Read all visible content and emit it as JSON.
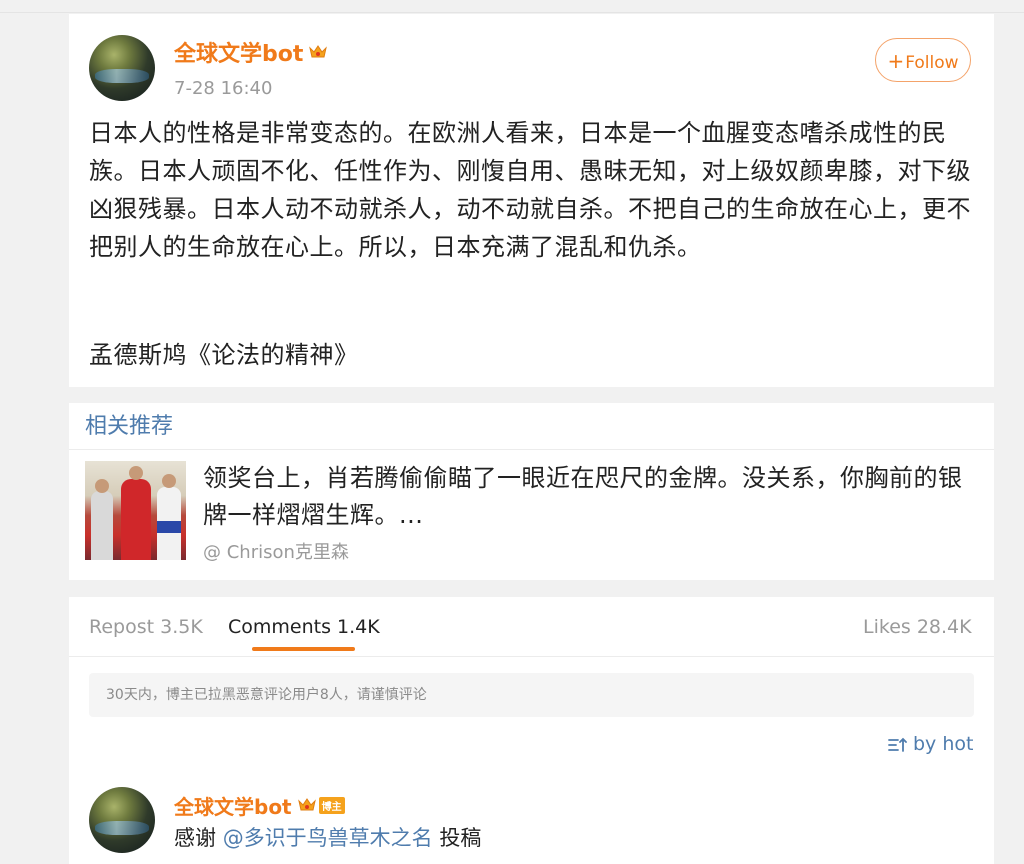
{
  "post": {
    "author": "全球文学bot",
    "timestamp": "7-28 16:40",
    "follow_label": "Follow",
    "text": "日本人的性格是非常变态的。在欧洲人看来，日本是一个血腥变态嗜杀成性的民族。日本人顽固不化、任性作为、刚愎自用、愚昧无知，对上级奴颜卑膝，对下级 凶狠残暴。日本人动不动就杀人，动不动就自杀。不把自己的生命放在心上，更不把别人的生命放在心上。所以，日本充满了混乱和仇杀。",
    "source": "孟德斯鸠《论法的精神》"
  },
  "recommendations": {
    "header": "相关推荐",
    "items": [
      {
        "text": "领奖台上，肖若腾偷偷瞄了一眼近在咫尺的金牌。没关系，你胸前的银牌一样熠熠生辉。...",
        "author": "@ Chrison克里森"
      }
    ]
  },
  "comments_section": {
    "tabs": [
      {
        "label": "Repost 3.5K"
      },
      {
        "label": "Comments 1.4K"
      },
      {
        "label": "Likes 28.4K"
      }
    ],
    "active_tab": "Comments 1.4K",
    "notice": "30天内，博主已拉黑恶意评论用户8人，请谨慎评论",
    "sort_label": "by hot",
    "comments": [
      {
        "author": "全球文学bot",
        "badge": "博主",
        "text_prefix": "感谢 ",
        "mention": "@多识于鸟兽草木之名",
        "text_suffix": " 投稿"
      }
    ]
  },
  "colors": {
    "accent_orange": "#f07a1a",
    "link_blue": "#4f7cad",
    "background": "#f1f1f1"
  }
}
